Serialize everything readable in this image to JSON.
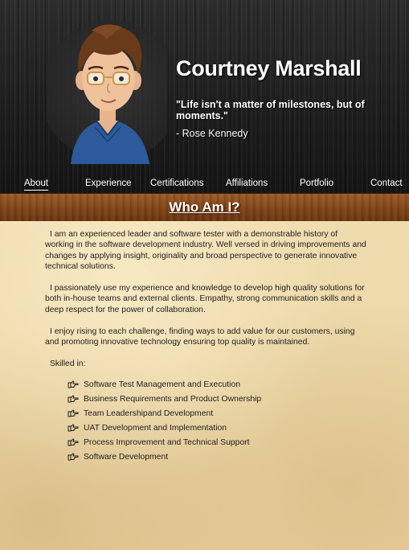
{
  "header": {
    "name": "Courtney Marshall",
    "quote": "\"Life isn't a matter of milestones, but of moments.\"",
    "quote_author": "- Rose Kennedy"
  },
  "nav": {
    "items": [
      {
        "label": "About",
        "active": true
      },
      {
        "label": "Experience",
        "active": false
      },
      {
        "label": "Certifications",
        "active": false
      },
      {
        "label": "Affiliations",
        "active": false
      },
      {
        "label": "Portfolio",
        "active": false
      },
      {
        "label": "Contact",
        "active": false
      }
    ]
  },
  "section": {
    "title": "Who Am I?"
  },
  "about": {
    "paragraphs": [
      "I am an experienced leader and software tester with a demonstrable history of working in the software development industry. Well versed in driving improvements and changes by applying insight, originality and broad perspective to generate innovative technical solutions.",
      "I passionately use my experience and knowledge to develop high quality solutions for both in-house teams and external clients. Empathy, strong communication skills and a deep respect for the power of collaboration.",
      "I enjoy rising to each challenge, finding ways to add value for our customers, using and promoting innovative technology ensuring top quality is maintained."
    ],
    "skilled_label": "Skilled in:",
    "skills": [
      "Software Test Management and Execution",
      "Business Requirements and Product Ownership",
      "Team Leadershipand Development",
      "UAT Development and Implementation",
      "Process Improvement and Technical Support",
      "Software Development"
    ]
  },
  "icons": {
    "bullet": "pointing-hand-icon",
    "avatar": "cartoon-avatar"
  },
  "colors": {
    "header_bg": "#1e1e1e",
    "section_bar": "#7c4218",
    "paper": "#e9d29f",
    "text": "#222222"
  }
}
